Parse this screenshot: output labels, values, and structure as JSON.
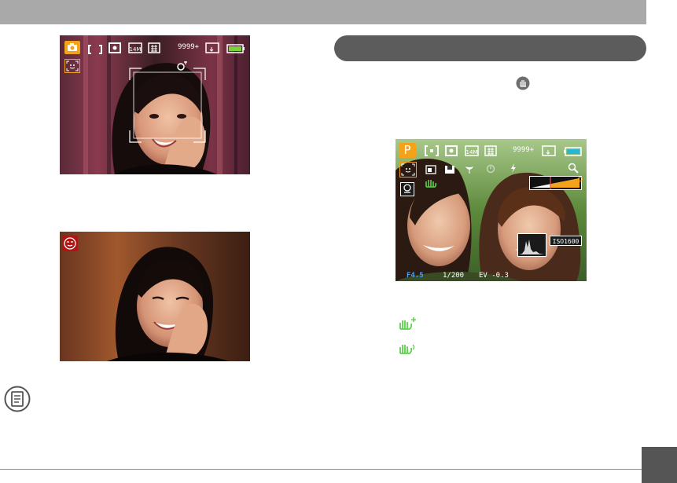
{
  "page": {
    "accent": "#f3a21a",
    "header_color": "#a9a9a9",
    "pill_color": "#5c5c5c",
    "tab_color": "#555555"
  },
  "photo1": {
    "shots_remaining": "9999+",
    "icons": [
      "camera-mode-icon",
      "af-area-icon",
      "metering-icon",
      "resolution-14m-icon",
      "quality-icon",
      "card-icon",
      "battery-icon",
      "smile-detect-icon",
      "face-detect-icon"
    ],
    "resolution_label": "14M"
  },
  "photo2": {
    "icons": [
      "blink-detect-icon"
    ]
  },
  "photo3": {
    "mode_label": "P",
    "shots_remaining": "9999+",
    "resolution_label": "14M",
    "iso_label": "ISO1600",
    "aperture": "F4.5",
    "shutter": "1/200",
    "ev": "EV -0.3",
    "icons": [
      "af-area-icon",
      "metering-icon",
      "resolution-14m-icon",
      "quality-icon",
      "card-icon",
      "battery-icon",
      "face-detect-icon",
      "white-balance-icon",
      "exposure-icon",
      "macro-icon",
      "self-timer-icon",
      "flash-icon",
      "zoom-icon",
      "stabilizer-icon",
      "continuous-icon",
      "zoom-bar",
      "histogram"
    ]
  },
  "legend": [
    {
      "icon": "hand-shake-plus-icon"
    },
    {
      "icon": "hand-shake-icon"
    }
  ],
  "note_icon": "note-icon",
  "inline_icon": "stabilizer-round-icon"
}
